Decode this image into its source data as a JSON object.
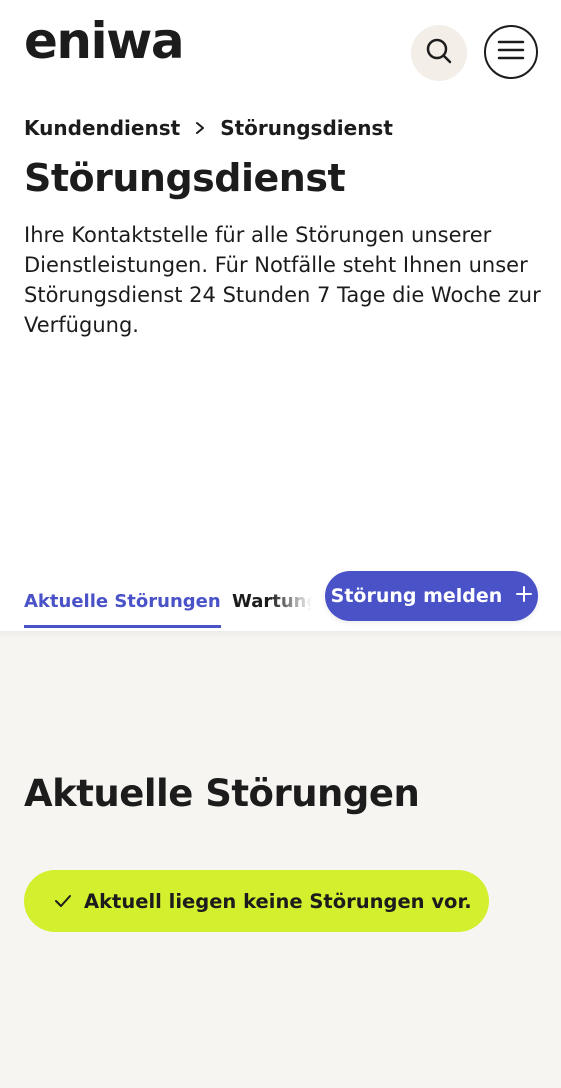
{
  "header": {
    "logo": "eniwa",
    "search_icon": "search-icon",
    "menu_icon": "hamburger-menu-icon"
  },
  "breadcrumb": {
    "items": [
      "Kundendienst",
      "Störungsdienst"
    ],
    "separator_icon": "chevron-right-icon"
  },
  "page": {
    "title": "Störungsdienst",
    "intro": "Ihre Kontaktstelle für alle Störungen unserer Dienstleistungen. Für Notfälle steht Ihnen unser Störungsdienst 24 Stunden 7 Tage die Woche zur Verfügung."
  },
  "tabs": {
    "items": [
      {
        "label": "Aktuelle Störungen",
        "active": true
      },
      {
        "label": "Wartung",
        "active": false
      }
    ],
    "visible_second_label": "Wartung"
  },
  "report_button": {
    "label": "Störung melden",
    "icon": "plus-icon"
  },
  "content": {
    "section_title": "Aktuelle Störungen",
    "status": {
      "icon": "check-icon",
      "text": "Aktuell liegen keine Störungen vor."
    }
  },
  "colors": {
    "accent": "#4a52c8",
    "status_background": "#d4ef2e",
    "content_background": "#f7f5f2",
    "search_button_background": "#f3efe8",
    "text": "#1c1c1c"
  }
}
